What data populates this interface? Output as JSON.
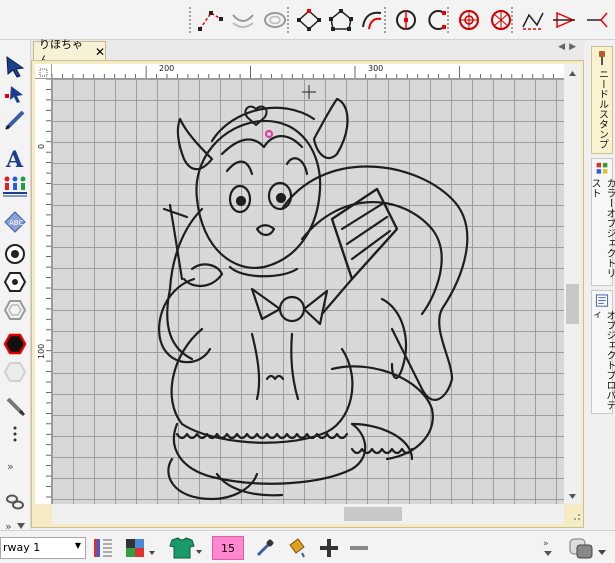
{
  "document": {
    "tab_title": "りほちゃん",
    "close_glyph": "✕"
  },
  "rulers": {
    "horizontal": [
      "200",
      "300"
    ],
    "vertical": [
      "0",
      "100"
    ]
  },
  "right_panel": {
    "tabs": [
      {
        "label": "ニードルスタンプ",
        "icon": "needle-stamp-icon"
      },
      {
        "label": "カラーオブジェクトリスト",
        "icon": "color-list-icon"
      },
      {
        "label": "オブジェクトプロパティ",
        "icon": "object-properties-icon"
      }
    ]
  },
  "bottom": {
    "layer_name": "rway 1",
    "number_badge": "15"
  },
  "colors": {
    "accent_tab": "#fbf3cf",
    "badge": "#ff86cf",
    "canvas_bg": "#d8d8d8",
    "grid": "#9e9e9e",
    "active_red": "#e30000"
  }
}
